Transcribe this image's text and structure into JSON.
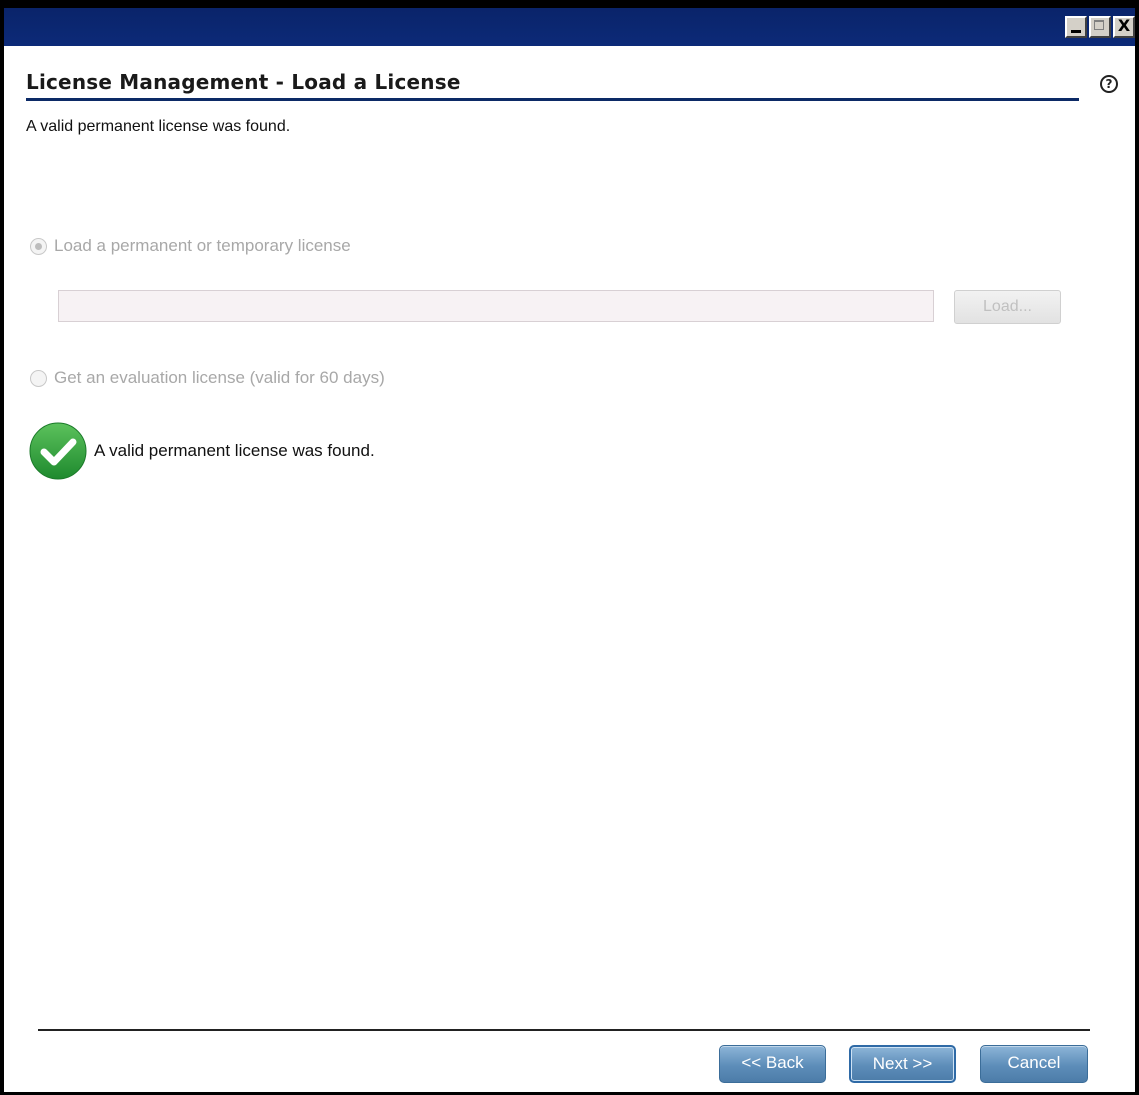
{
  "window": {
    "controls": {
      "minimize": "",
      "maximize": "",
      "close": "X"
    }
  },
  "header": {
    "title": "License Management - Load a License",
    "help_glyph": "?"
  },
  "subtitle": "A valid permanent license was found.",
  "options": {
    "load_license": {
      "label": "Load a permanent or temporary license",
      "selected": true,
      "enabled": false
    },
    "file_path": {
      "value": "",
      "placeholder": ""
    },
    "load_button": "Load...",
    "evaluation": {
      "label": "Get an evaluation license (valid for 60 days)",
      "selected": false,
      "enabled": false
    }
  },
  "status": {
    "icon": "check-circle-icon",
    "message": "A valid permanent license was found.",
    "color": "#2e9a3c"
  },
  "footer": {
    "back_label": "<< Back",
    "next_label": "Next >>",
    "cancel_label": "Cancel"
  },
  "colors": {
    "titlebar": "#0a246a",
    "accent_rule": "#0c2a66",
    "button_blue": "#5d8db9"
  }
}
